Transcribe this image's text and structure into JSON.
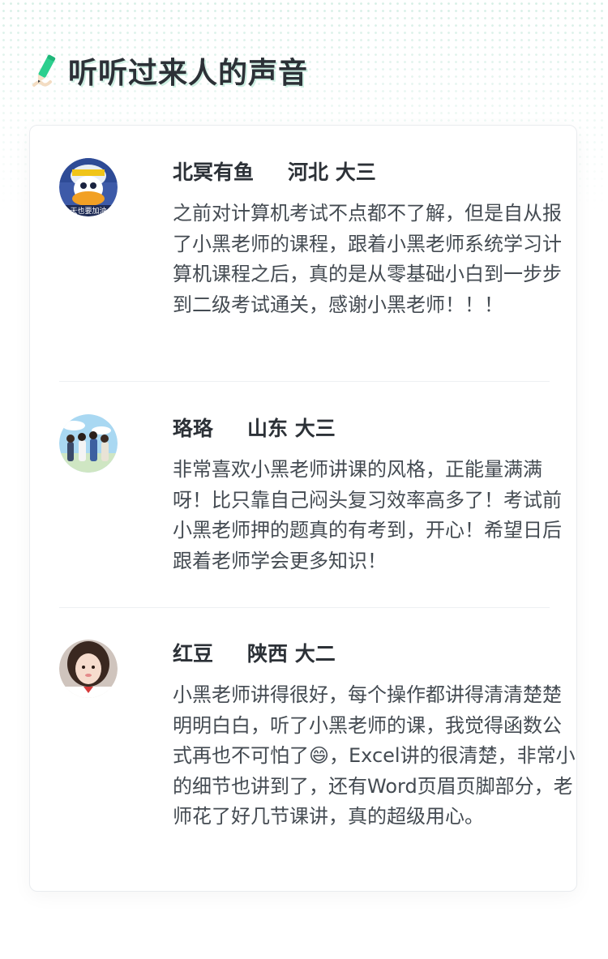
{
  "section": {
    "title": "听听过来人的声音",
    "accent_color": "#2ccf8e",
    "icon": "pencil-icon"
  },
  "reviews": [
    {
      "name": "北冥有鱼",
      "location": "河北 大三",
      "avatar": "avatar-photo",
      "text": "之前对计算机考试不点都不了解，但是自从报了小黑老师的课程，跟着小黑老师系统学习计算机课程之后，真的是从零基础小白到一步步到二级考试通关，感谢小黑老师！！！"
    },
    {
      "name": "珞珞",
      "location": "山东 大三",
      "avatar": "avatar-photo",
      "text": "非常喜欢小黑老师讲课的风格，正能量满满呀！比只靠自己闷头复习效率高多了！考试前小黑老师押的题真的有考到，开心！希望日后跟着老师学会更多知识！"
    },
    {
      "name": "红豆",
      "location": "陕西 大二",
      "avatar": "avatar-photo",
      "text": "小黑老师讲得很好，每个操作都讲得清清楚楚明明白白，听了小黑老师的课，我觉得函数公式再也不可怕了😄，Excel讲的很清楚，非常小的细节也讲到了，还有Word页眉页脚部分，老师花了好几节课讲，真的超级用心。"
    }
  ]
}
